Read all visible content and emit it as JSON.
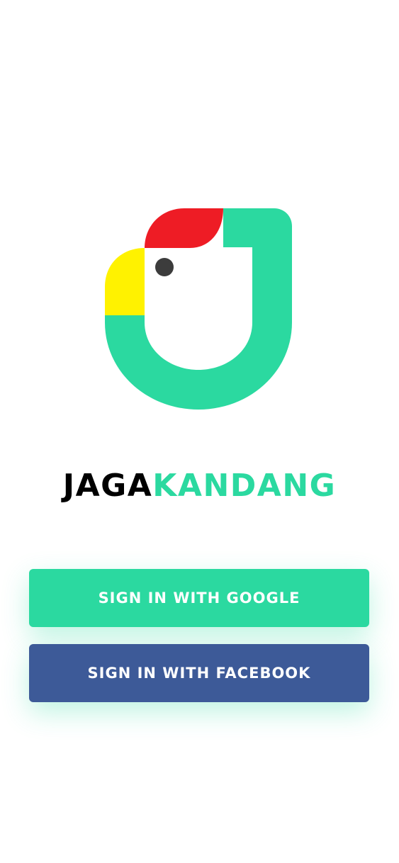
{
  "brand": {
    "name_part1": "JAGA",
    "name_part2": "KANDANG"
  },
  "buttons": {
    "google_label": "SIGN IN WITH GOOGLE",
    "facebook_label": "SIGN IN WITH FACEBOOK"
  },
  "colors": {
    "primary_green": "#2bd9a0",
    "facebook_blue": "#3d5a98",
    "comb_red": "#ee1c25",
    "beak_yellow": "#fff200",
    "eye_dark": "#3c3c3c"
  },
  "logo": {
    "icon": "rooster-j-logo-icon"
  }
}
